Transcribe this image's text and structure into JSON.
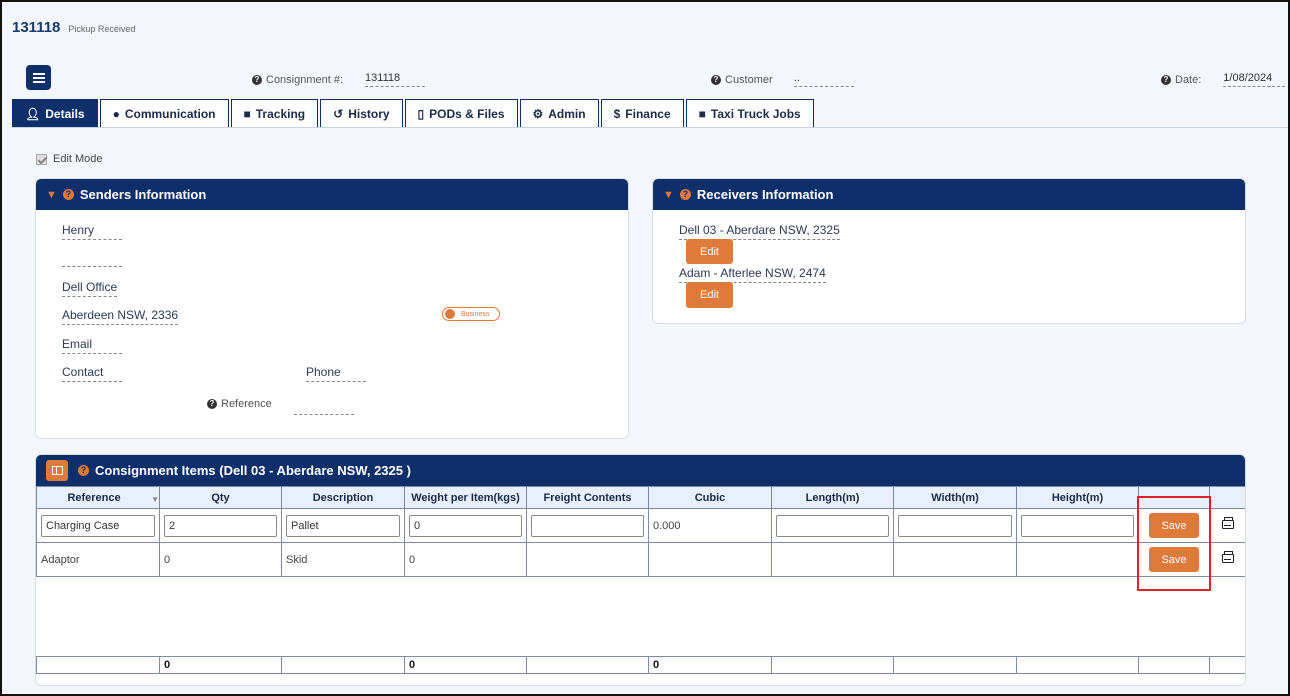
{
  "header": {
    "number": "131118",
    "status": "Pickup Received",
    "consignment_label": "Consignment #:",
    "consignment_value": "131118",
    "customer_label": "Customer",
    "customer_value": "..",
    "date_label": "Date:",
    "date_value": "1/08/2024"
  },
  "tabs": [
    {
      "label": "Details",
      "icon": "user-icon"
    },
    {
      "label": "Communication",
      "icon": "comment-icon"
    },
    {
      "label": "Tracking",
      "icon": "truck-icon"
    },
    {
      "label": "History",
      "icon": "history-icon"
    },
    {
      "label": "PODs & Files",
      "icon": "file-icon"
    },
    {
      "label": "Admin",
      "icon": "gear-icon"
    },
    {
      "label": "Finance",
      "icon": "dollar-icon"
    },
    {
      "label": "Taxi Truck Jobs",
      "icon": "truck-icon"
    }
  ],
  "edit_mode_label": "Edit Mode",
  "senders": {
    "title": "Senders Information",
    "name": "Henry",
    "company": "Dell Office",
    "suburb": "Aberdeen NSW, 2336",
    "business_toggle": "Business",
    "email": "Email",
    "contact": "Contact",
    "phone": "Phone",
    "reference_label": "Reference"
  },
  "receivers": {
    "title": "Receivers Information",
    "entries": [
      "Dell 03 - Aberdare NSW, 2325",
      "Adam - Afterlee NSW, 2474"
    ],
    "edit_label": "Edit"
  },
  "items": {
    "title": "Consignment Items (Dell 03 - Aberdare NSW, 2325 )",
    "columns": [
      "Reference",
      "Qty",
      "Description",
      "Weight per Item(kgs)",
      "Freight Contents",
      "Cubic",
      "Length(m)",
      "Width(m)",
      "Height(m)"
    ],
    "rows": [
      {
        "reference": "Charging Case",
        "qty": "2",
        "description": "Pallet",
        "weight": "0",
        "freight": "",
        "cubic": "0.000",
        "length": "",
        "width": "",
        "height": ""
      },
      {
        "reference": "Adaptor",
        "qty": "0",
        "description": "Skid",
        "weight": "0",
        "freight": "",
        "cubic": "",
        "length": "",
        "width": "",
        "height": ""
      }
    ],
    "save_label": "Save",
    "totals": {
      "qty": "0",
      "weight": "0",
      "cubic": "0"
    }
  }
}
